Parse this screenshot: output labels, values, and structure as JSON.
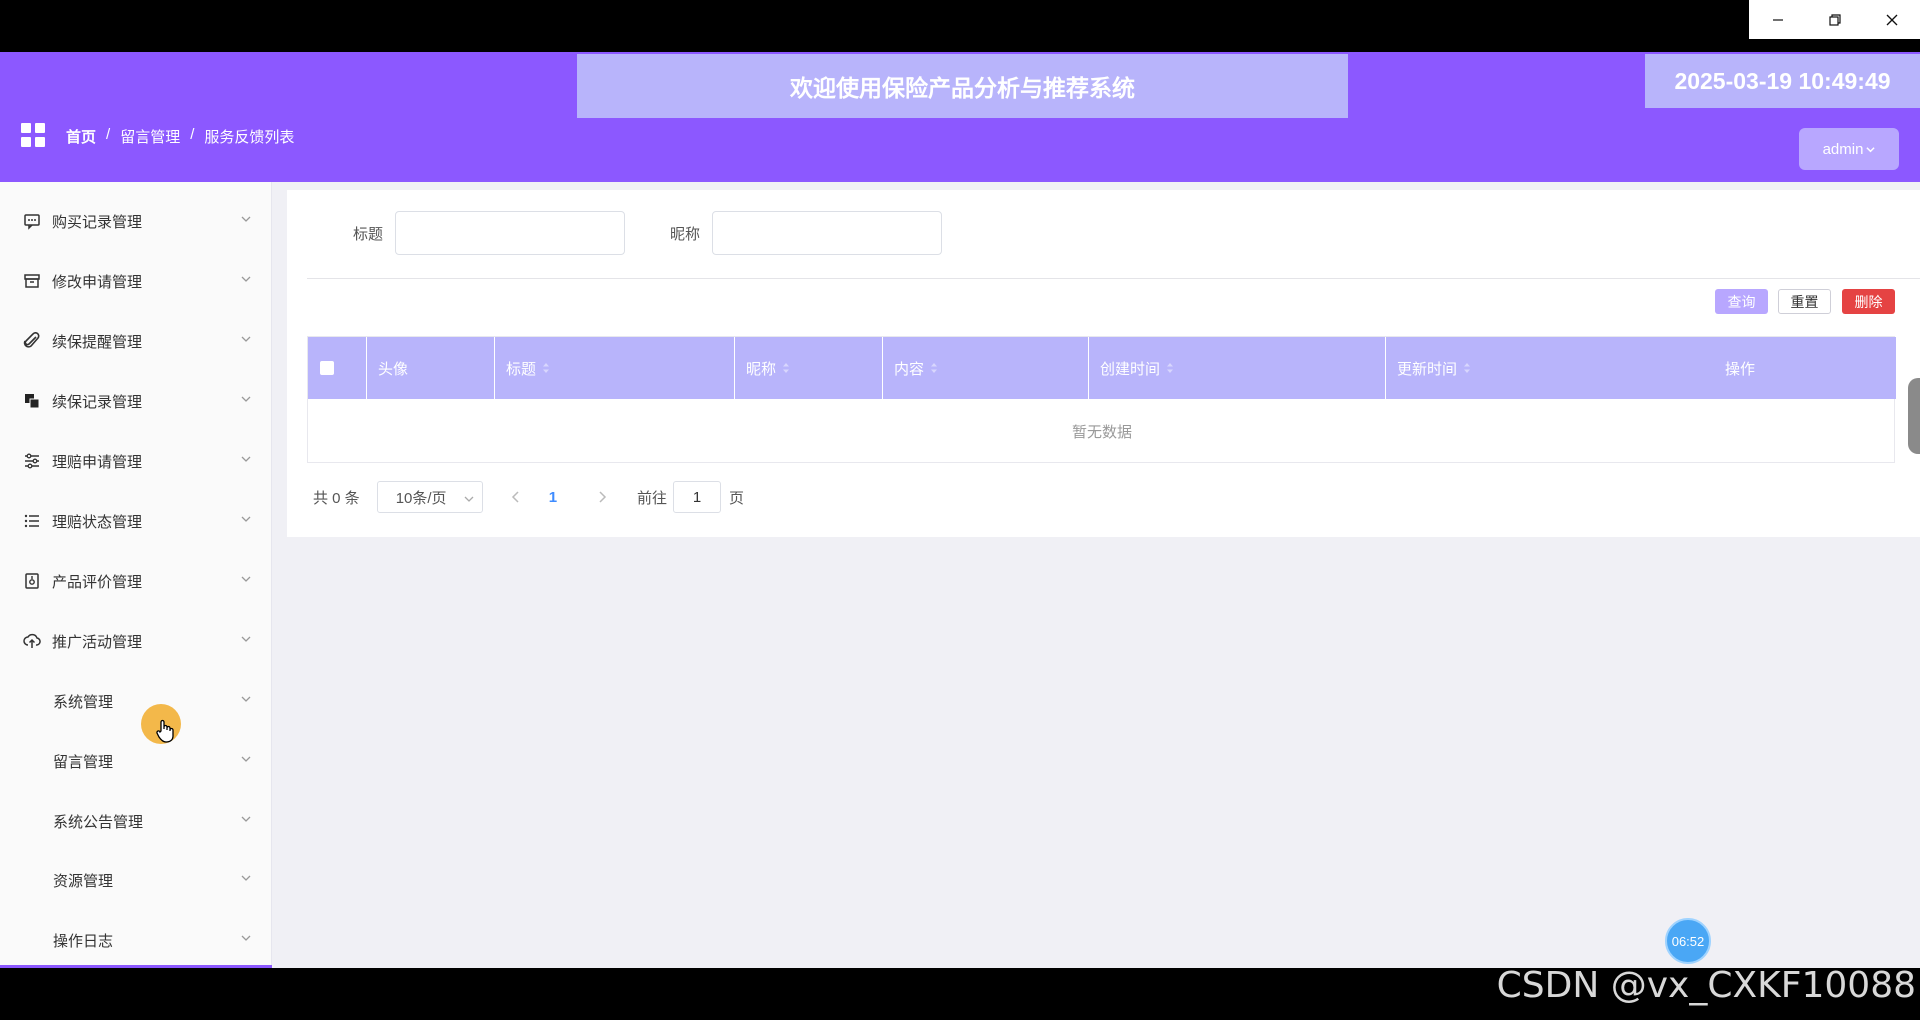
{
  "window": {
    "controls": [
      "minimize-icon",
      "restore-icon",
      "close-icon"
    ]
  },
  "header": {
    "welcome": "欢迎使用保险产品分析与推荐系统",
    "datetime": "2025-03-19 10:49:49",
    "breadcrumb": [
      "首页",
      "/",
      "留言管理",
      "/",
      "服务反馈列表"
    ],
    "user": "admin",
    "accent": "#8c58ff"
  },
  "sidebar": {
    "items": [
      {
        "label": "购买记录管理",
        "icon": "message-icon"
      },
      {
        "label": "修改申请管理",
        "icon": "archive-icon"
      },
      {
        "label": "续保提醒管理",
        "icon": "paperclip-icon"
      },
      {
        "label": "续保记录管理",
        "icon": "copy-icon"
      },
      {
        "label": "理赔申请管理",
        "icon": "sliders-icon"
      },
      {
        "label": "理赔状态管理",
        "icon": "list-icon"
      },
      {
        "label": "产品评价管理",
        "icon": "lock-icon"
      },
      {
        "label": "推广活动管理",
        "icon": "cloud-upload-icon"
      },
      {
        "label": "系统管理",
        "icon": ""
      },
      {
        "label": "留言管理",
        "icon": ""
      },
      {
        "label": "系统公告管理",
        "icon": ""
      },
      {
        "label": "资源管理",
        "icon": ""
      },
      {
        "label": "操作日志",
        "icon": ""
      }
    ]
  },
  "search": {
    "title_label": "标题",
    "nickname_label": "昵称",
    "title_value": "",
    "nickname_value": ""
  },
  "actions": {
    "query": "查询",
    "reset": "重置",
    "delete": "删除"
  },
  "table": {
    "columns": [
      "头像",
      "标题",
      "昵称",
      "内容",
      "创建时间",
      "更新时间",
      "操作"
    ],
    "empty_text": "暂无数据",
    "header_color": "#b8b4fb"
  },
  "pagination": {
    "total": "共 0 条",
    "page_size": "10条/页",
    "current_page": "1",
    "goto_label": "前往",
    "goto_value": "1",
    "page_suffix": "页"
  },
  "overlay": {
    "timer": "06:52",
    "watermark": "CSDN @vx_CXKF10088"
  }
}
